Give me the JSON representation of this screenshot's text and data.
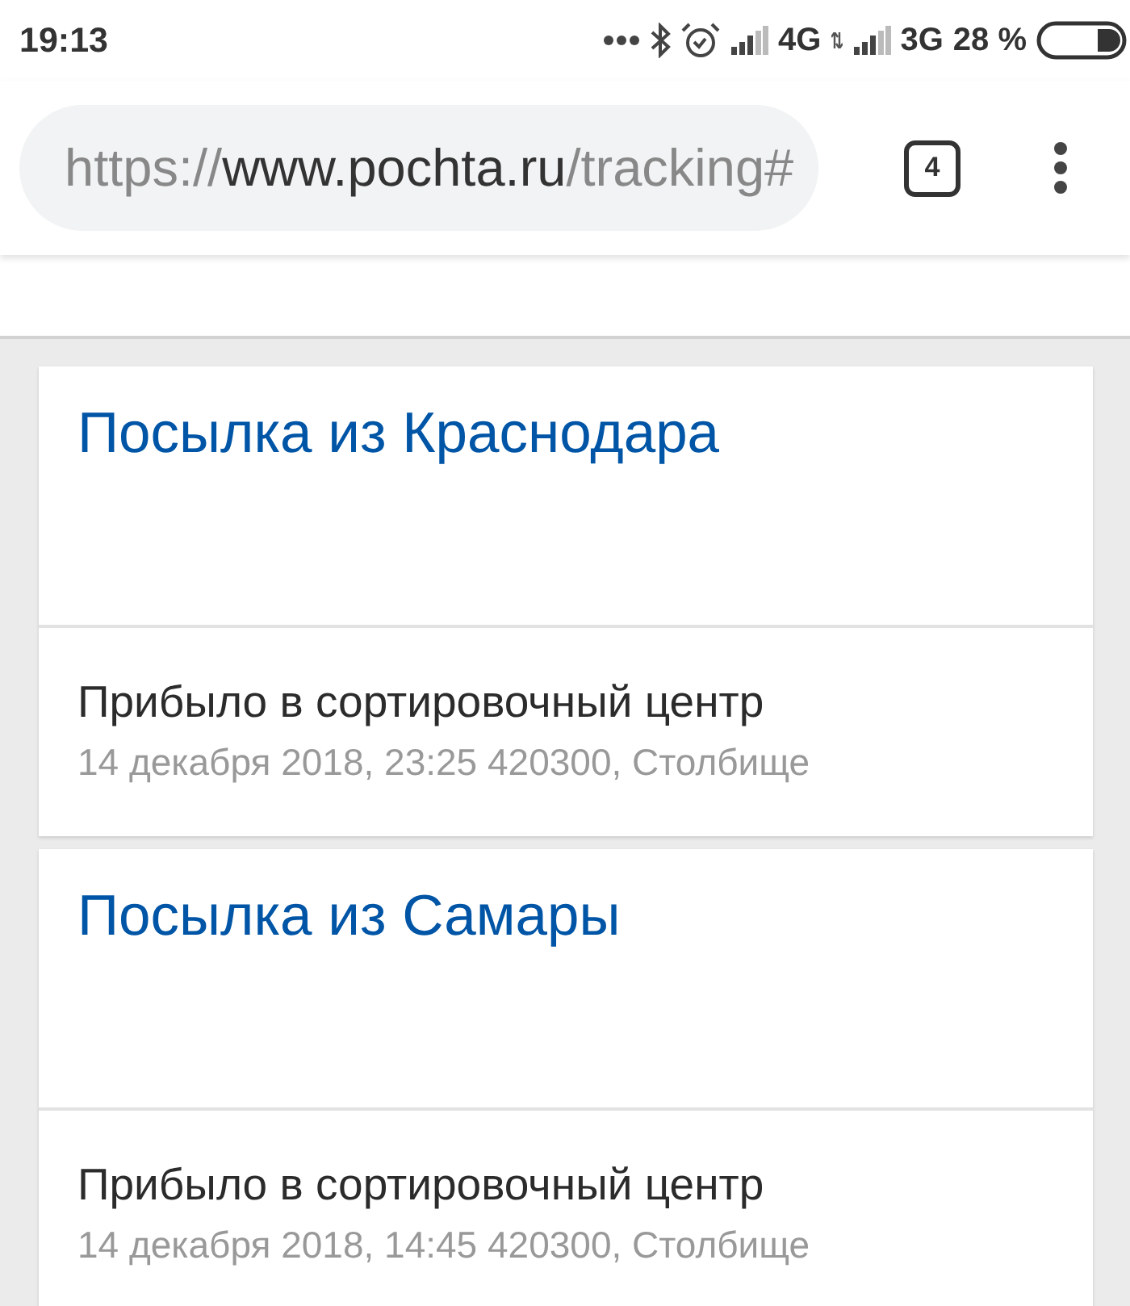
{
  "status_bar": {
    "time": "19:13",
    "network_1": "4G",
    "network_2": "3G",
    "battery": "28 %"
  },
  "browser": {
    "url": {
      "scheme": "https://",
      "host": "www.pochta.ru",
      "path": "/tracking#"
    },
    "tab_count": "4"
  },
  "parcels": [
    {
      "title": "Посылка из Краснодара",
      "status": "Прибыло в сортировочный центр",
      "details": "14 декабря 2018, 23:25 420300, Столбище"
    },
    {
      "title": "Посылка из Самары",
      "status": "Прибыло в сортировочный центр",
      "details": "14 декабря 2018, 14:45 420300, Столбище"
    }
  ]
}
